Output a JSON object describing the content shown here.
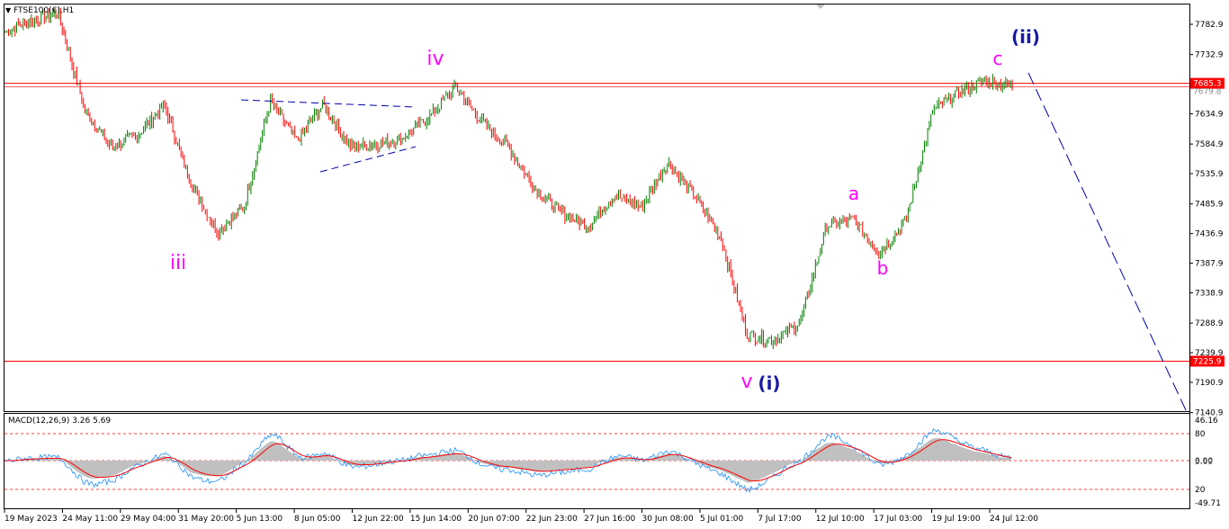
{
  "chart": {
    "title": "FTSE100(€),H1",
    "indicator": "MACD(12,26,9) 3.26 5.69"
  },
  "price_axis": {
    "ticks": [
      "7782.9",
      "7732.9",
      "7685.3",
      "7634.9",
      "7584.9",
      "7535.9",
      "7485.9",
      "7436.9",
      "7387.9",
      "7338.9",
      "7288.9",
      "7239.9",
      "7190.9",
      "7140.9"
    ],
    "levels": [
      {
        "label": "7685.3",
        "value": 7685.3,
        "color": "#ff0000",
        "bg": "#ff0000"
      },
      {
        "label": "7225.9",
        "value": 7225.9,
        "color": "#ff0000",
        "bg": "#ff0000"
      }
    ],
    "price_overlay_label": "7679.8"
  },
  "macd_axis": {
    "ticks": [
      "46.16",
      "80",
      "0.00",
      "20",
      "-49.71"
    ],
    "current": "5.69"
  },
  "time_axis": {
    "labels": [
      "19 May 2023",
      "24 May 11:00",
      "29 May 04:00",
      "31 May 20:00",
      "5 Jun 13:00",
      "8 Jun 05:00",
      "12 Jun 22:00",
      "15 Jun 14:00",
      "20 Jun 07:00",
      "22 Jun 23:00",
      "27 Jun 16:00",
      "30 Jun 08:00",
      "5 Jul 01:00",
      "7 Jul 17:00",
      "12 Jul 10:00",
      "17 Jul 03:00",
      "19 Jul 19:00",
      "24 Jul 12:00"
    ]
  },
  "waves": [
    {
      "id": "iii",
      "text": "iii",
      "color": "#ff00ff"
    },
    {
      "id": "iv",
      "text": "iv",
      "color": "#ff00ff"
    },
    {
      "id": "v",
      "text": "v",
      "color": "#ff00ff"
    },
    {
      "id": "i",
      "text": "(i)",
      "color": "#1a1aa6"
    },
    {
      "id": "a",
      "text": "a",
      "color": "#ff00ff"
    },
    {
      "id": "b",
      "text": "b",
      "color": "#ff00ff"
    },
    {
      "id": "c",
      "text": "c",
      "color": "#ff00ff"
    },
    {
      "id": "ii",
      "text": "(ii)",
      "color": "#1a1aa6"
    }
  ],
  "colors": {
    "bull": "#008000",
    "bear": "#ff0000",
    "grid": "#000000",
    "level_line": "#ff0000",
    "projection": "#0000aa",
    "macd_line": "#1e90ff",
    "signal_line": "#ff0000",
    "histogram": "#c0c0c0"
  },
  "chart_data": {
    "type": "candlestick",
    "symbol": "FTSE100(€)",
    "timeframe": "H1",
    "close_path_anchors": [
      [
        "19 May 2023",
        7770
      ],
      [
        "",
        7790
      ],
      [
        "",
        7800
      ],
      [
        "24 May 11:00",
        7640
      ],
      [
        "",
        7580
      ],
      [
        "",
        7600
      ],
      [
        "29 May 04:00",
        7650
      ],
      [
        "",
        7520
      ],
      [
        "31 May 20:00",
        7440
      ],
      [
        "",
        7480
      ],
      [
        "5 Jun 13:00",
        7655
      ],
      [
        "",
        7590
      ],
      [
        "",
        7650
      ],
      [
        "8 Jun 05:00",
        7580
      ],
      [
        "",
        7585
      ],
      [
        "12 Jun 22:00",
        7595
      ],
      [
        "",
        7630
      ],
      [
        "15 Jun 14:00",
        7680
      ],
      [
        "",
        7620
      ],
      [
        "20 Jun 07:00",
        7580
      ],
      [
        "",
        7510
      ],
      [
        "22 Jun 23:00",
        7470
      ],
      [
        "",
        7450
      ],
      [
        "27 Jun 16:00",
        7500
      ],
      [
        "",
        7480
      ],
      [
        "30 Jun 08:00",
        7555
      ],
      [
        "",
        7500
      ],
      [
        "5 Jul 01:00",
        7430
      ],
      [
        "",
        7270
      ],
      [
        "7 Jul 17:00",
        7260
      ],
      [
        "",
        7290
      ],
      [
        "12 Jul 10:00",
        7450
      ],
      [
        "",
        7460
      ],
      [
        "17 Jul 03:00",
        7405
      ],
      [
        "",
        7460
      ],
      [
        "19 Jul 19:00",
        7640
      ],
      [
        "",
        7670
      ],
      [
        "24 Jul 12:00",
        7690
      ],
      [
        "",
        7680
      ]
    ],
    "horizontal_levels": [
      7685.3,
      7225.9
    ],
    "ylim": [
      7140.9,
      7800
    ],
    "macd": {
      "name": "MACD(12,26,9)",
      "main": 3.26,
      "signal": 5.69
    }
  }
}
